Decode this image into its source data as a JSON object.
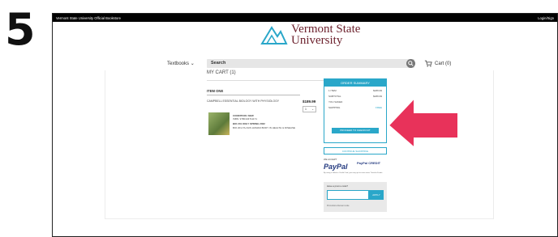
{
  "step": "5",
  "topbar": {
    "left": "Vermont State University Official Bookstore",
    "right": "Login/Sign"
  },
  "logo": {
    "line1": "Vermont State",
    "line2": "University"
  },
  "nav": {
    "textbooks": "Textbooks",
    "search": "Search",
    "cart": "Cart (0)"
  },
  "cart": {
    "heading": "MY CART (1)",
    "item_heading": "ITEM ONE",
    "item": {
      "title": "CAMPBELL ESSENTIAL BIOLOGY WITH PHYSIOLOGY",
      "price": "$189.99",
      "qty": "1",
      "condition": "CONDITION: NEW",
      "isbn": "ISBN: 9780134711171",
      "course1": "BIO 201 ONLY SPRING 2022",
      "course2": "BIO 201-TA-NUS HUMAN BODY IN HEALTH & DISEASE"
    }
  },
  "summary": {
    "title": "ORDER SUMMARY",
    "rows": [
      {
        "label": "1 ITEM",
        "value": "$189.99"
      },
      {
        "label": "SUBTOTAL",
        "value": "$189.99"
      },
      {
        "label": "YOU SAVED",
        "value": ""
      },
      {
        "label": "SHIPPING",
        "value": "FREE"
      }
    ],
    "checkout": "PROCEED TO CHECKOUT",
    "continue": "CONTINUE SHOPPING",
    "we_accept": "WE ACCEPT",
    "paypal": "PayPal",
    "credit": "PayPal CREDIT",
    "fine_print": "By using a Debit or Credit Card, you may opt to enter more Transfer Funds.",
    "promo_question": "Have a promo code?",
    "promo_button": "APPLY",
    "promo_footer": "Promotions discount code"
  },
  "colors": {
    "accent": "#2aa7c9",
    "brand": "#6b1f2b",
    "arrow": "#e8325a"
  }
}
